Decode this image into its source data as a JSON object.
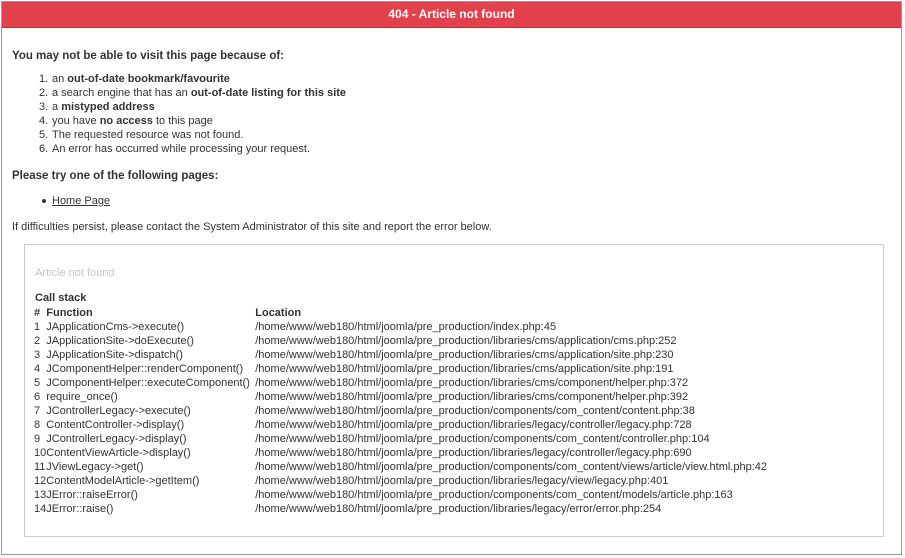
{
  "header": {
    "title": "404 - Article not found"
  },
  "reasons": {
    "title": "You may not be able to visit this page because of:",
    "items": [
      {
        "pre": "an ",
        "bold": "out-of-date bookmark/favourite",
        "post": ""
      },
      {
        "pre": "a search engine that has an ",
        "bold": "out-of-date listing for this site",
        "post": ""
      },
      {
        "pre": "a ",
        "bold": "mistyped address",
        "post": ""
      },
      {
        "pre": "you have ",
        "bold": "no access",
        "post": " to this page"
      },
      {
        "pre": "The requested resource was not found.",
        "bold": "",
        "post": ""
      },
      {
        "pre": "An error has occurred while processing your request.",
        "bold": "",
        "post": ""
      }
    ]
  },
  "try": {
    "title": "Please try one of the following pages:",
    "links": [
      "Home Page"
    ]
  },
  "persist_text": "If difficulties persist, please contact the System Administrator of this site and report the error below.",
  "error": {
    "message": "Article not found",
    "callstack_title": "Call stack",
    "columns": {
      "num": "#",
      "function": "Function",
      "location": "Location"
    },
    "rows": [
      {
        "num": "1",
        "fn": "JApplicationCms->execute()",
        "loc": "/home/www/web180/html/joomla/pre_production/index.php:45"
      },
      {
        "num": "2",
        "fn": "JApplicationSite->doExecute()",
        "loc": "/home/www/web180/html/joomla/pre_production/libraries/cms/application/cms.php:252"
      },
      {
        "num": "3",
        "fn": "JApplicationSite->dispatch()",
        "loc": "/home/www/web180/html/joomla/pre_production/libraries/cms/application/site.php:230"
      },
      {
        "num": "4",
        "fn": "JComponentHelper::renderComponent()",
        "loc": "/home/www/web180/html/joomla/pre_production/libraries/cms/application/site.php:191"
      },
      {
        "num": "5",
        "fn": "JComponentHelper::executeComponent()",
        "loc": "/home/www/web180/html/joomla/pre_production/libraries/cms/component/helper.php:372"
      },
      {
        "num": "6",
        "fn": "require_once()",
        "loc": "/home/www/web180/html/joomla/pre_production/libraries/cms/component/helper.php:392"
      },
      {
        "num": "7",
        "fn": "JControllerLegacy->execute()",
        "loc": "/home/www/web180/html/joomla/pre_production/components/com_content/content.php:38"
      },
      {
        "num": "8",
        "fn": "ContentController->display()",
        "loc": "/home/www/web180/html/joomla/pre_production/libraries/legacy/controller/legacy.php:728"
      },
      {
        "num": "9",
        "fn": "JControllerLegacy->display()",
        "loc": "/home/www/web180/html/joomla/pre_production/components/com_content/controller.php:104"
      },
      {
        "num": "10",
        "fn": "ContentViewArticle->display()",
        "loc": "/home/www/web180/html/joomla/pre_production/libraries/legacy/controller/legacy.php:690"
      },
      {
        "num": "11",
        "fn": "JViewLegacy->get()",
        "loc": "/home/www/web180/html/joomla/pre_production/components/com_content/views/article/view.html.php:42"
      },
      {
        "num": "12",
        "fn": "ContentModelArticle->getItem()",
        "loc": "/home/www/web180/html/joomla/pre_production/libraries/legacy/view/legacy.php:401"
      },
      {
        "num": "13",
        "fn": "JError::raiseError()",
        "loc": "/home/www/web180/html/joomla/pre_production/components/com_content/models/article.php:163"
      },
      {
        "num": "14",
        "fn": "JError::raise()",
        "loc": "/home/www/web180/html/joomla/pre_production/libraries/legacy/error/error.php:254"
      }
    ]
  },
  "colors": {
    "header_bg": "#e2404a",
    "text": "#333333",
    "muted": "#c4c4c4"
  }
}
